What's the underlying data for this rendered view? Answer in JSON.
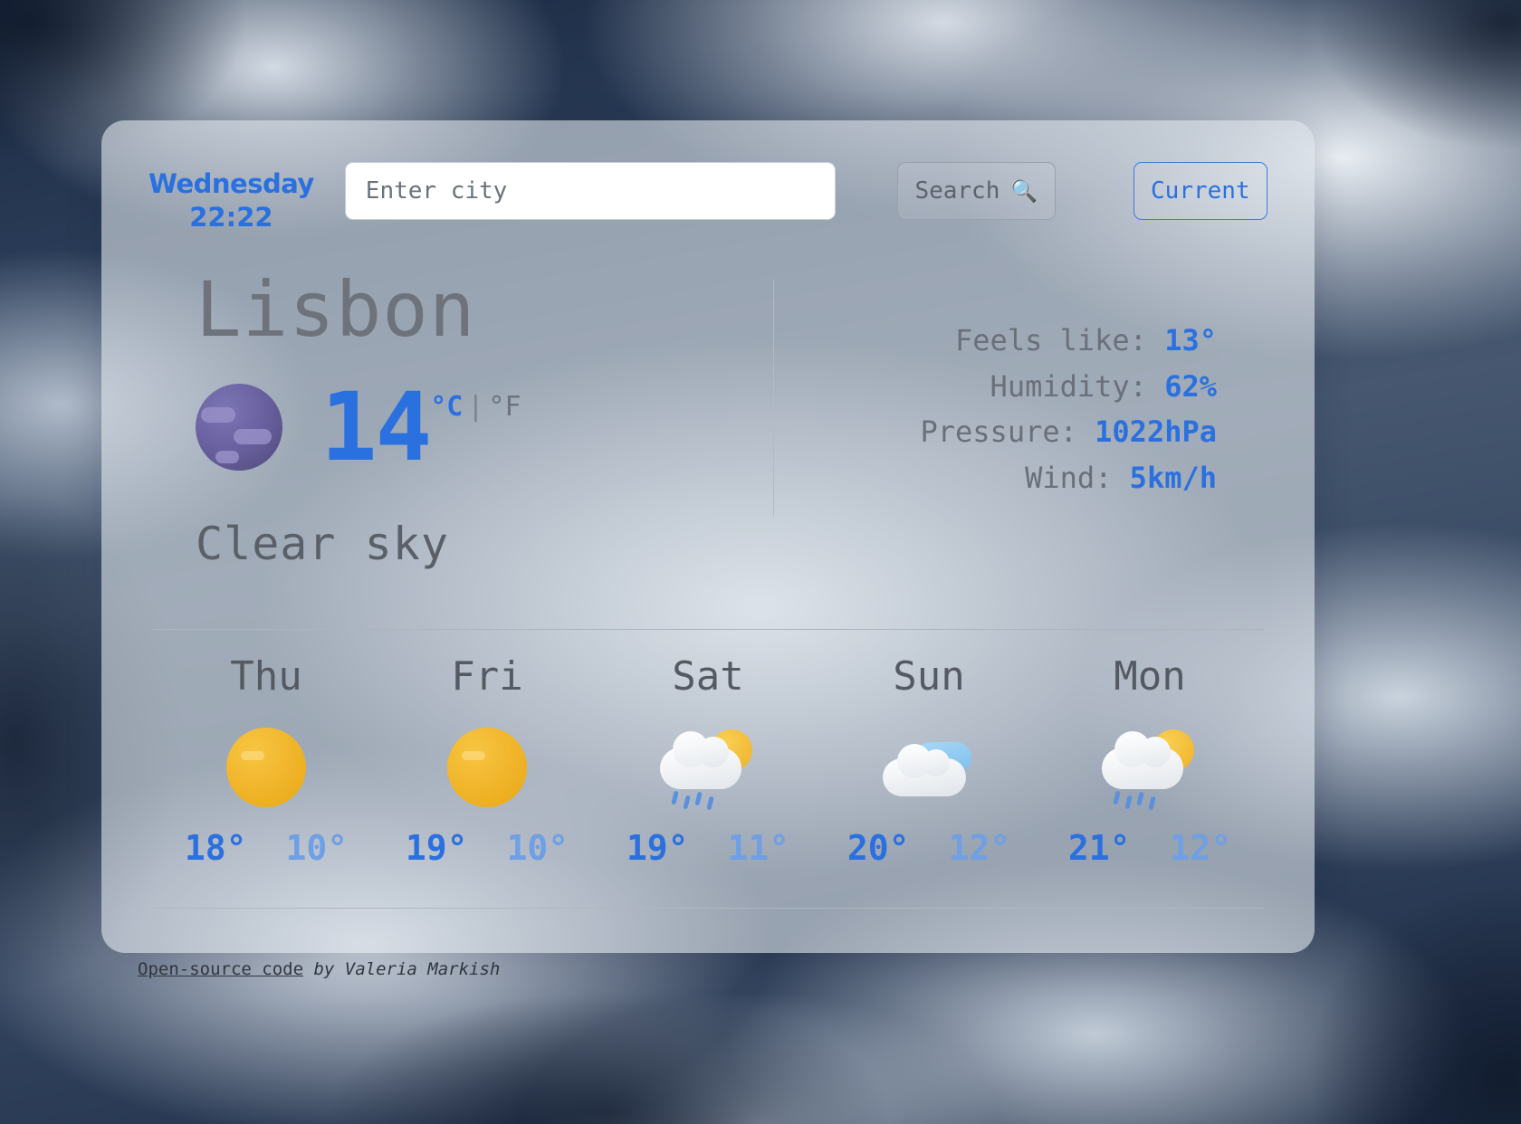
{
  "header": {
    "day_name": "Wednesday",
    "time": "22:22",
    "search_placeholder": "Enter city",
    "search_value": "",
    "search_button": "Search",
    "search_icon": "magnifier-icon",
    "search_icon_glyph": "🔍",
    "current_button": "Current"
  },
  "current": {
    "city": "Lisbon",
    "icon": "new-moon-face-icon",
    "temperature": "14",
    "unit_celsius": "°C",
    "unit_separator": "|",
    "unit_fahrenheit": "°F",
    "condition": "Clear sky",
    "details": [
      {
        "label": "Feels like:",
        "value": "13°"
      },
      {
        "label": "Humidity:",
        "value": "62%"
      },
      {
        "label": "Pressure:",
        "value": "1022hPa"
      },
      {
        "label": "Wind:",
        "value": "5km/h"
      }
    ]
  },
  "forecast": [
    {
      "day": "Thu",
      "icon": "sun-icon",
      "max": "18°",
      "min": "10°"
    },
    {
      "day": "Fri",
      "icon": "sun-icon",
      "max": "19°",
      "min": "10°"
    },
    {
      "day": "Sat",
      "icon": "sun-rain-cloud-icon",
      "max": "19°",
      "min": "11°"
    },
    {
      "day": "Sun",
      "icon": "cloud-icon",
      "max": "20°",
      "min": "12°"
    },
    {
      "day": "Mon",
      "icon": "sun-rain-cloud-icon",
      "max": "21°",
      "min": "12°"
    }
  ],
  "footer": {
    "link_text": "Open-source code",
    "credit_text": " by Valeria Markish"
  },
  "colors": {
    "accent_blue": "#2b70df",
    "muted_blue": "#6f9fe4",
    "text_gray": "#6e737b",
    "card_bg": "rgba(218,224,231,0.62)"
  }
}
